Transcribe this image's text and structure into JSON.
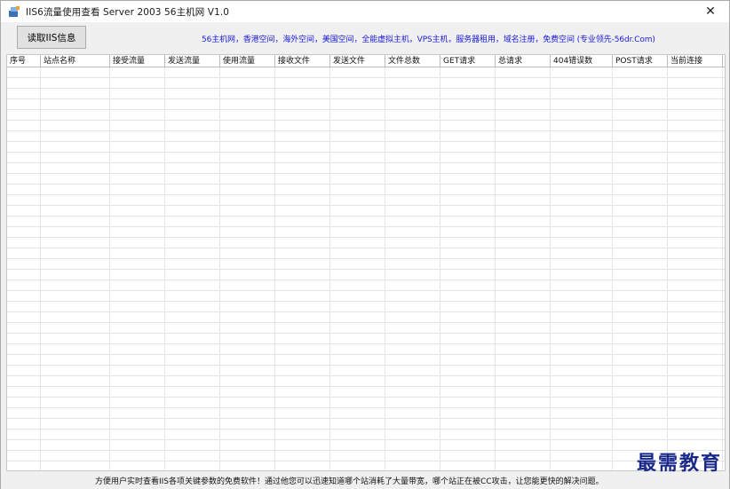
{
  "window": {
    "title": "IIS6流量使用查看 Server 2003 56主机网 V1.0",
    "icon": "app-icon",
    "close_label": "✕"
  },
  "toolbar": {
    "read_button_label": "读取IIS信息",
    "ad_text": "56主机网，香港空间，海外空间，美国空间，全能虚拟主机，VPS主机，服务器租用，域名注册，免费空间 (专业领先-56dr.Com)"
  },
  "grid": {
    "columns": [
      {
        "label": "序号"
      },
      {
        "label": "站点名称"
      },
      {
        "label": "接受流量"
      },
      {
        "label": "发送流量"
      },
      {
        "label": "使用流量"
      },
      {
        "label": "接收文件"
      },
      {
        "label": "发送文件"
      },
      {
        "label": "文件总数"
      },
      {
        "label": "GET请求"
      },
      {
        "label": "总请求"
      },
      {
        "label": "404错误数"
      },
      {
        "label": "POST请求"
      },
      {
        "label": "当前连接"
      }
    ]
  },
  "status": {
    "text": "方便用户实时查看IIS各项关键参数的免费软件！通过他您可以迅速知道哪个站消耗了大量带宽，哪个站正在被CC攻击，让您能更快的解决问题。"
  },
  "watermark": {
    "text": "最需教育"
  }
}
